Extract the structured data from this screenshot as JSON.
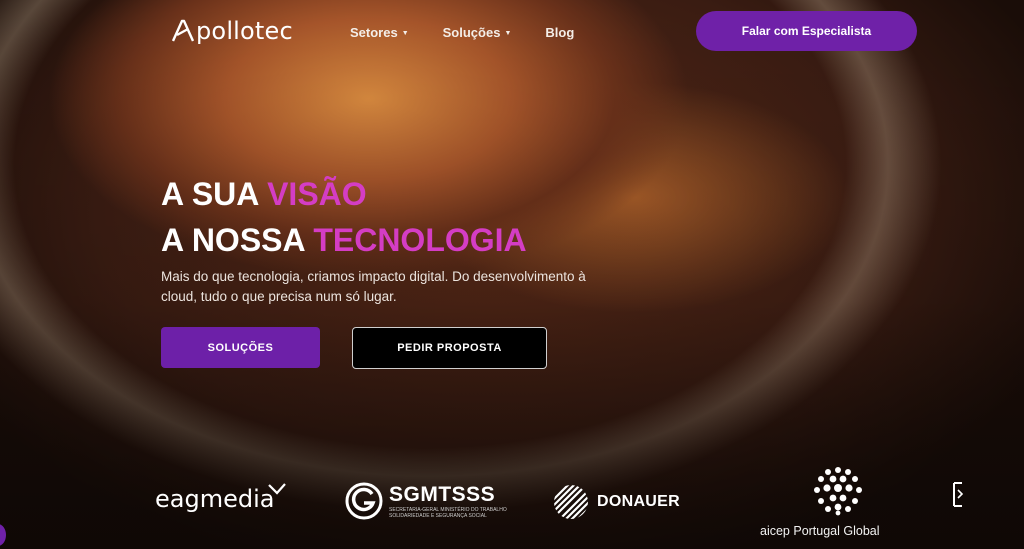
{
  "nav": {
    "logo_text": "pollotec",
    "menu": [
      {
        "label": "Setores",
        "has_dropdown": true
      },
      {
        "label": "Soluções",
        "has_dropdown": true
      },
      {
        "label": "Blog",
        "has_dropdown": false
      }
    ],
    "cta_label": "Falar com Especialista"
  },
  "hero": {
    "line1_prefix": "A SUA",
    "line1_accent": "VISÃO",
    "line2_prefix": "A NOSSA",
    "line2_accent": "TECNOLOGIA",
    "subtitle": "Mais do que tecnologia, criamos impacto digital. Do desenvolvimento à cloud, tudo o que precisa num só lugar.",
    "primary_button": "SOLUÇÕES",
    "secondary_button": "PEDIR PROPOSTA"
  },
  "clients": {
    "eag": "eagmedia",
    "sgm_title": "SGMTSSS",
    "sgm_sub_line1": "SECRETARIA-GERAL MINISTÉRIO DO TRABALHO",
    "sgm_sub_line2": "SOLIDARIEDADE E SEGURANÇA SOCIAL",
    "donauer": "DONAUER",
    "aicep": "aicep Portugal Global"
  },
  "colors": {
    "accent_magenta": "#d43dc4",
    "brand_purple": "#6f21a8"
  }
}
